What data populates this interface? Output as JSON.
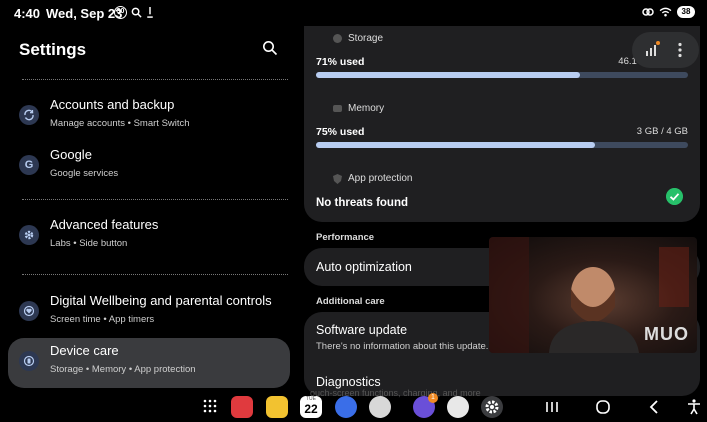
{
  "status_bar": {
    "time": "4:40",
    "date": "Wed, Sep 23",
    "badge_left": "30",
    "battery": "38"
  },
  "left": {
    "title": "Settings",
    "items": [
      {
        "title": "Accounts and backup",
        "subtitle": "Manage accounts  •  Smart Switch",
        "icon": "sync-icon"
      },
      {
        "title": "Google",
        "subtitle": "Google services",
        "icon": "google-icon"
      },
      {
        "title": "Advanced features",
        "subtitle": "Labs  •  Side button",
        "icon": "gear-plus-icon"
      },
      {
        "title": "Digital Wellbeing and parental controls",
        "subtitle": "Screen time  •  App timers",
        "icon": "heart-icon"
      },
      {
        "title": "Device care",
        "subtitle": "Storage  •  Memory  •  App protection",
        "icon": "device-care-icon"
      }
    ]
  },
  "right": {
    "storage": {
      "label": "Storage",
      "used": "71% used",
      "amount": "46.1 GB / 64 GB",
      "fraction": 0.71
    },
    "memory": {
      "label": "Memory",
      "used": "75% used",
      "amount": "3 GB / 4 GB",
      "fraction": 0.75
    },
    "protection": {
      "label": "App protection",
      "status": "No threats found"
    },
    "performance_heading": "Performance",
    "auto_optimization": "Auto optimization",
    "additional_heading": "Additional care",
    "software_update": {
      "title": "Software update",
      "subtitle": "There's no information about this update."
    },
    "diagnostics": "Diagnostics",
    "faded_text": "ouch-screen functions, charging, and more"
  },
  "video": {
    "watermark": "MUO"
  },
  "taskbar": {
    "calendar_day": "22",
    "calendar_month": "TUE",
    "search_badge": "1"
  },
  "colors": {
    "accent": "#b8cdf1",
    "active_bg": "#3a3b3e",
    "card_bg": "#1f1f21",
    "check": "#27c06a"
  }
}
